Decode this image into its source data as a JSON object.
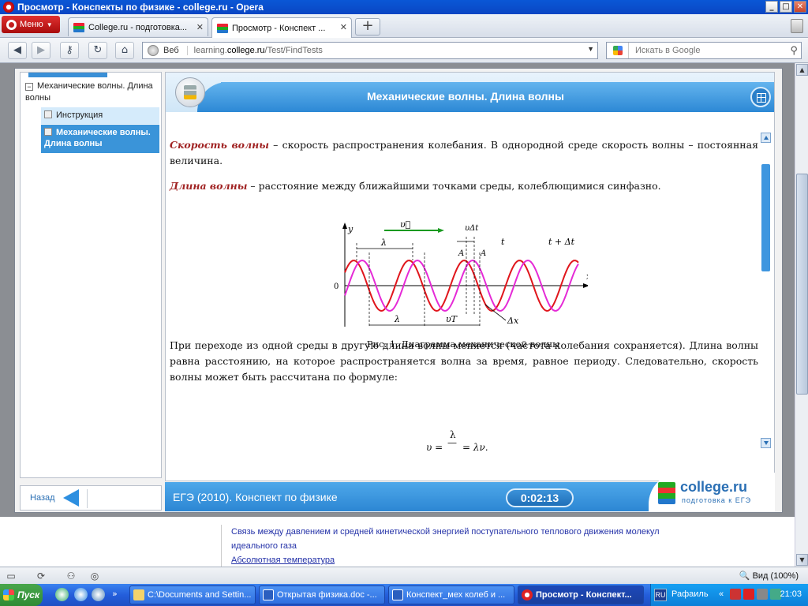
{
  "window": {
    "title": "Просмотр - Конспекты по физике - college.ru - Opera",
    "buttons": {
      "minimize": "_",
      "maximize": "□",
      "close": "✕"
    }
  },
  "tabs": {
    "menu_label": "Меню",
    "items": [
      {
        "label": "College.ru - подготовка..."
      },
      {
        "label": "Просмотр - Конспект ..."
      }
    ],
    "new_tab": "+",
    "close_glyph": "✕"
  },
  "nav": {
    "back": "◀",
    "forward": "▶",
    "reload": "↻",
    "home": "⌂",
    "web_label": "Веб",
    "url_prefix": "learning.",
    "url_domain": "college.ru",
    "url_path": "/Test/FindTests",
    "search_placeholder": "Искать в Google",
    "dropdown": "▼",
    "search_glyph": "⚲"
  },
  "sidebar": {
    "node_toggle": "−",
    "node_label": "Механические волны. Длина волны",
    "items": [
      {
        "label": "Инструкция"
      },
      {
        "label": "Механические волны. Длина волны"
      }
    ],
    "back_label": "Назад"
  },
  "lesson": {
    "title": "Механические волны. Длина волны",
    "p1_term": "Скорость волны",
    "p1_text": " – скорость распространения колебания. В однородной среде скорость волны – постоянная величина.",
    "p2_term": "Длина волны",
    "p2_text": " – расстояние между ближайшими точками среды, колеблющимися синфазно.",
    "caption": "Рис. 1. Диаграмма механической волны",
    "p3_text": "При переходе из одной среды в другую длина волны меняется (частота колебания сохраняется). Длина волны равна расстоянию, на которое распространяется волна за время, равное периоду. Следовательно, скорость волны может быть рассчитана по формуле:",
    "formula": {
      "lhs": "υ =",
      "numerator": "λ",
      "denominator": "—",
      "rhs": "= λν."
    },
    "figure": {
      "y_axis": "y",
      "x_axis": "x",
      "origin": "0",
      "velocity": "υ⃗",
      "lambda": "λ",
      "v_dt": "υΔt",
      "point_a": "A",
      "t": "t",
      "t_dt": "t + Δt",
      "v_T": "υT",
      "dx": "Δx"
    },
    "colors": {
      "wave_t": "#e0161c",
      "wave_t_dt": "#e52ad6",
      "arrow": "#1a9a20",
      "accent": "#2c88d5"
    }
  },
  "footer": {
    "title": "ЕГЭ (2010). Конспект по физике",
    "timer": "0:02:13",
    "logo_text": "college.ru",
    "logo_sub": "подготовка к ЕГЭ"
  },
  "underlying": {
    "line1": "Связь между давлением и средней кинетической энергией поступательного теплового движения молекул",
    "line2": "идеального газа",
    "line3": "Абсолютная температура"
  },
  "statusbar": {
    "zoom": "Вид (100%)"
  },
  "taskbar": {
    "start": "Пуск",
    "more": "»",
    "buttons": [
      {
        "label": "C:\\Documents and Settin..."
      },
      {
        "label": "Открытая физика.doc -..."
      },
      {
        "label": "Конспект_мех колеб и ..."
      },
      {
        "label": "Просмотр - Конспект..."
      }
    ],
    "lang": "RU",
    "user": "Рафаиль",
    "tray_more": "«",
    "clock": "21:03"
  }
}
